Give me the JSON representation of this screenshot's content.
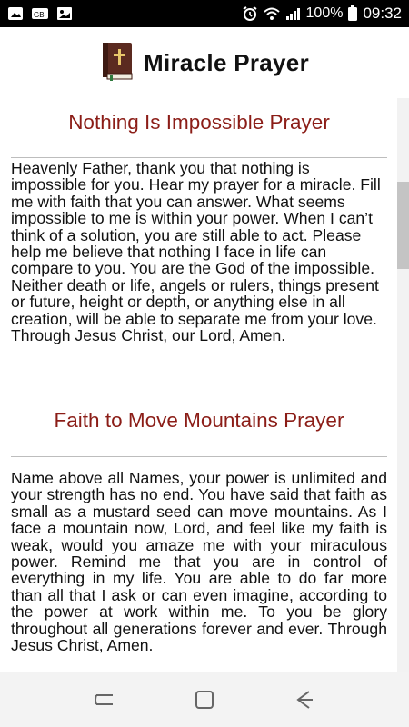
{
  "status_bar": {
    "battery_text": "100%",
    "time": "09:32",
    "icons": [
      "image-icon",
      "news-icon",
      "gallery-icon",
      "alarm-icon",
      "wifi-icon",
      "signal-icon",
      "battery-icon"
    ]
  },
  "app": {
    "title": "Miracle Prayer",
    "logo_icon": "bible-icon"
  },
  "prayers": [
    {
      "title": "Nothing Is Impossible Prayer",
      "text": "Heavenly Father, thank you that nothing is impossible for you. Hear my prayer for a miracle. Fill me with faith that you can answer. What seems impossible to me is within your power. When I can’t think of a solution, you are still able to act. Please help me believe that nothing I face in life can compare to you. You are the God of the impossible. Neither death or life, angels or rulers, things present or future, height or depth, or anything else in all creation, will be able to separate me from your love. Through Jesus Christ, our Lord, Amen."
    },
    {
      "title": "Faith to Move Mountains Prayer",
      "text": "Name above all Names, your power is unlimited and your strength has no end. You have said that faith as small as a mustard seed can move mountains. As I face a mountain now, Lord, and feel like my faith is weak, would you amaze me with your miraculous power. Remind me that you are in control of everything in my life. You are able to do far more than all that I ask or can even imagine, according to the power at work within me. To you be glory throughout all generations forever and ever. Through Jesus Christ, Amen."
    }
  ],
  "nav_bar": {
    "buttons": [
      "recent-apps",
      "home",
      "back"
    ]
  },
  "colors": {
    "status_bar_bg": "#000000",
    "title_red": "#8b1d17",
    "text": "#111111",
    "nav_bg": "#f3f3f3"
  }
}
